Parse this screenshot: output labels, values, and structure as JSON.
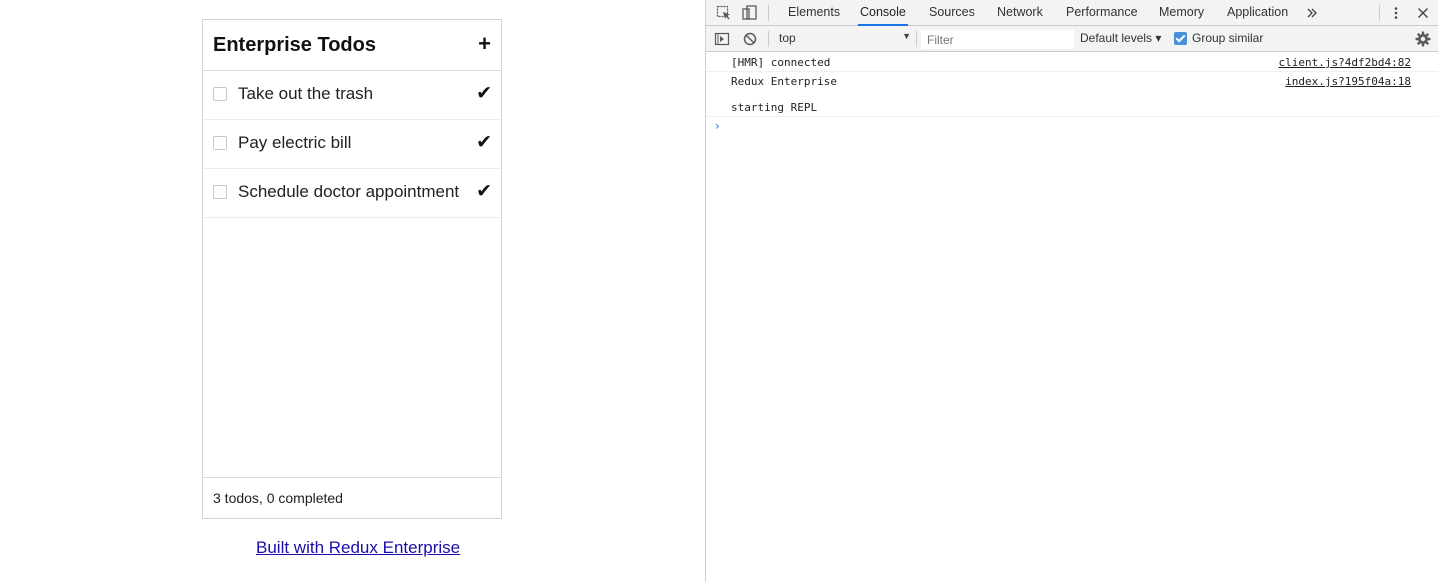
{
  "app": {
    "title": "Enterprise Todos",
    "add_label": "+",
    "todos": [
      {
        "text": "Take out the trash",
        "done_icon": "✔"
      },
      {
        "text": "Pay electric bill",
        "done_icon": "✔"
      },
      {
        "text": "Schedule doctor appointment",
        "done_icon": "✔"
      }
    ],
    "footer": "3 todos, 0 completed",
    "link": "Built with Redux Enterprise"
  },
  "devtools": {
    "tabs": [
      "Elements",
      "Console",
      "Sources",
      "Network",
      "Performance",
      "Memory",
      "Application"
    ],
    "active_tab": "Console",
    "more_tabs_icon": "double-chevron-right-icon",
    "context": "top",
    "filter_placeholder": "Filter",
    "levels": "Default levels ▾",
    "group_similar": "Group similar",
    "group_similar_checked": true,
    "logs": [
      {
        "message": "[HMR] connected",
        "source": "client.js?4df2bd4:82"
      },
      {
        "message": "Redux Enterprise\n\nstarting REPL",
        "source": "index.js?195f04a:18"
      }
    ],
    "prompt": "›",
    "accent": "#1a73e8"
  }
}
